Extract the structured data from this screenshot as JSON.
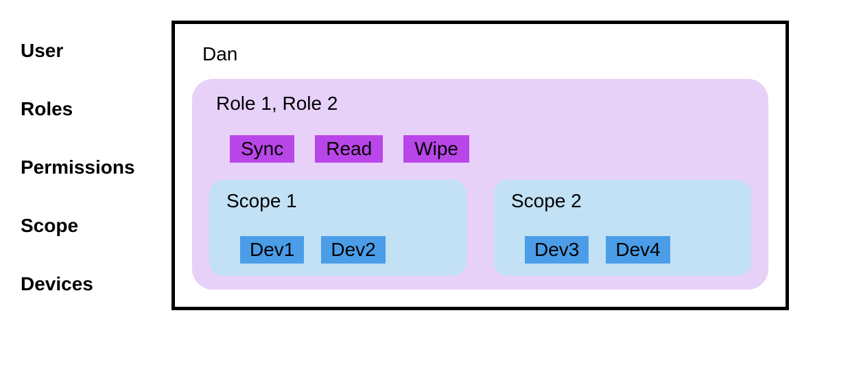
{
  "labels": {
    "user": "User",
    "roles": "Roles",
    "permissions": "Permissions",
    "scope": "Scope",
    "devices": "Devices"
  },
  "user": "Dan",
  "roles_text": "Role 1, Role 2",
  "permissions": [
    "Sync",
    "Read",
    "Wipe"
  ],
  "scopes": [
    {
      "name": "Scope 1",
      "devices": [
        "Dev1",
        "Dev2"
      ]
    },
    {
      "name": "Scope 2",
      "devices": [
        "Dev3",
        "Dev4"
      ]
    }
  ]
}
